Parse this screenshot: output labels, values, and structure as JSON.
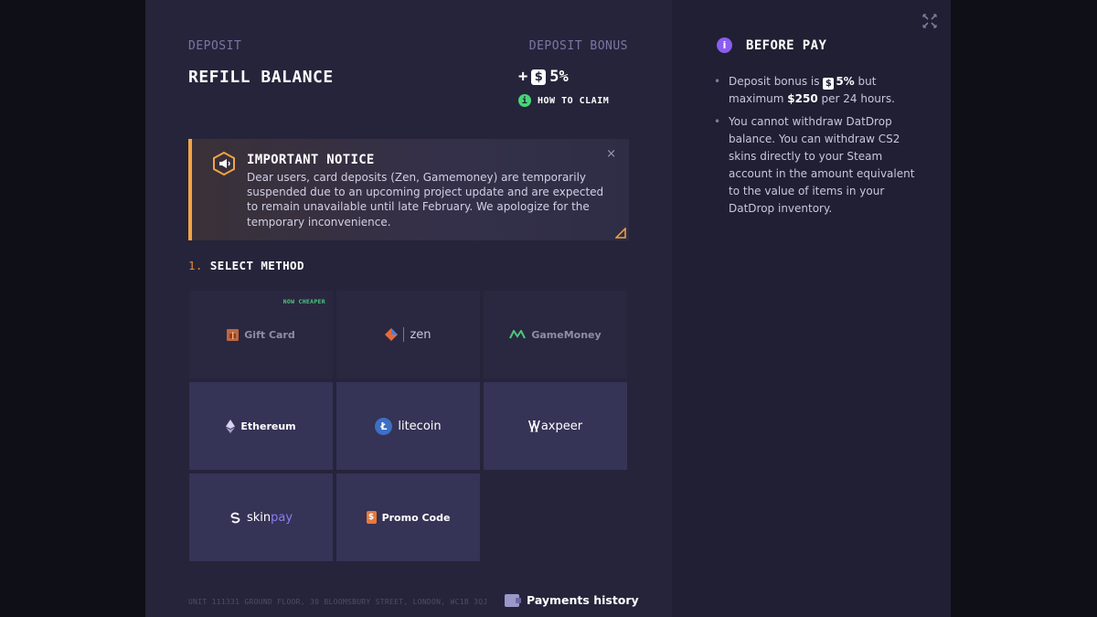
{
  "header": {
    "deposit_label": "DEPOSIT",
    "title": "REFILL BALANCE",
    "bonus_label": "DEPOSIT BONUS",
    "bonus_prefix": "+",
    "bonus_value": "5%",
    "how_to_claim": "HOW TO CLAIM"
  },
  "notice": {
    "title": "IMPORTANT NOTICE",
    "text": "Dear users, card deposits (Zen, Gamemoney) are temporarily suspended due to an upcoming project update and are expected to remain unavailable until late February. We apologize for the temporary inconvenience.",
    "close": "×"
  },
  "section": {
    "number": "1.",
    "title": "SELECT METHOD"
  },
  "methods": [
    {
      "label": "Gift Card",
      "tag": "NOW CHEAPER",
      "icon": "gift-card-icon"
    },
    {
      "label": "zen",
      "icon": "zen-logo-icon"
    },
    {
      "label": "GameMoney",
      "icon": "gamemoney-icon"
    },
    {
      "label": "Ethereum",
      "icon": "ethereum-icon"
    },
    {
      "label": "litecoin",
      "icon": "litecoin-icon"
    },
    {
      "label_a": "\\/\\/",
      "label_b": "axpeer",
      "icon": "waxpeer-logo-icon"
    },
    {
      "label_a": "skin",
      "label_b": "pay",
      "icon": "skinpay-icon"
    },
    {
      "label": "Promo Code",
      "icon": "promo-code-icon"
    }
  ],
  "footer": {
    "address": "UNIT 111331 GROUND FLOOR, 30 BLOOMSBURY STREET, LONDON, WC1B 3QJ",
    "payments_history": "Payments history"
  },
  "before_pay": {
    "title": "BEFORE PAY",
    "rule1_a": "Deposit bonus is ",
    "rule1_b": "5%",
    "rule1_c": " but maximum ",
    "rule1_d": "$250",
    "rule1_e": " per 24 hours.",
    "rule2": "You cannot withdraw DatDrop balance. You can withdraw CS2 skins directly to your Steam account in the amount equivalent to the value of items in your DatDrop inventory."
  },
  "colors": {
    "accent_orange": "#f2a444",
    "accent_green": "#47d47a",
    "accent_purple": "#8a5cf0",
    "panel": "#26243a"
  }
}
